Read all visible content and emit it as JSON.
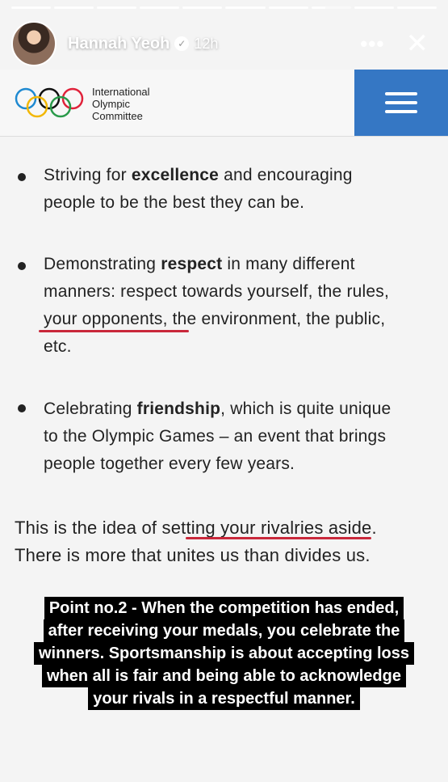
{
  "story": {
    "segments": 10,
    "username": "Hannah Yeoh",
    "time": "12h",
    "more_label": "•••",
    "close_label": "✕"
  },
  "ioc": {
    "line1": "International",
    "line2": "Olympic",
    "line3": "Committee",
    "ring_colors": [
      "#1f8ad1",
      "#f2b705",
      "#111111",
      "#2a9a4a",
      "#e0223a"
    ],
    "menu_color": "#3577c4"
  },
  "content": {
    "b1_pre": "Striving for ",
    "b1_bold": "excellence",
    "b1_post": " and encouraging",
    "b1_line2": "people to be the best they can be.",
    "b2_pre": "Demonstrating ",
    "b2_bold": "respect",
    "b2_post": " in many different",
    "b2_line2": "manners: respect towards yourself, the rules,",
    "b2_line3": "your opponents, the environment, the public,",
    "b2_line4": "etc.",
    "b3_pre": "Celebrating ",
    "b3_bold": "friendship",
    "b3_post": ", which is quite unique",
    "b3_line2": "to the Olympic Games – an event that brings",
    "b3_line3": "people together every few years.",
    "p1": "This is the idea of setting your rivalries aside.",
    "p2": "There is more that unites us than divides us."
  },
  "caption": {
    "line1": "Point no.2 - When the competition has ended,",
    "line2": "after receiving your medals, you celebrate the",
    "line3": "winners. Sportsmanship is about accepting loss",
    "line4": "when all is fair and being able to acknowledge",
    "line5": "your rivals in a respectful manner."
  }
}
